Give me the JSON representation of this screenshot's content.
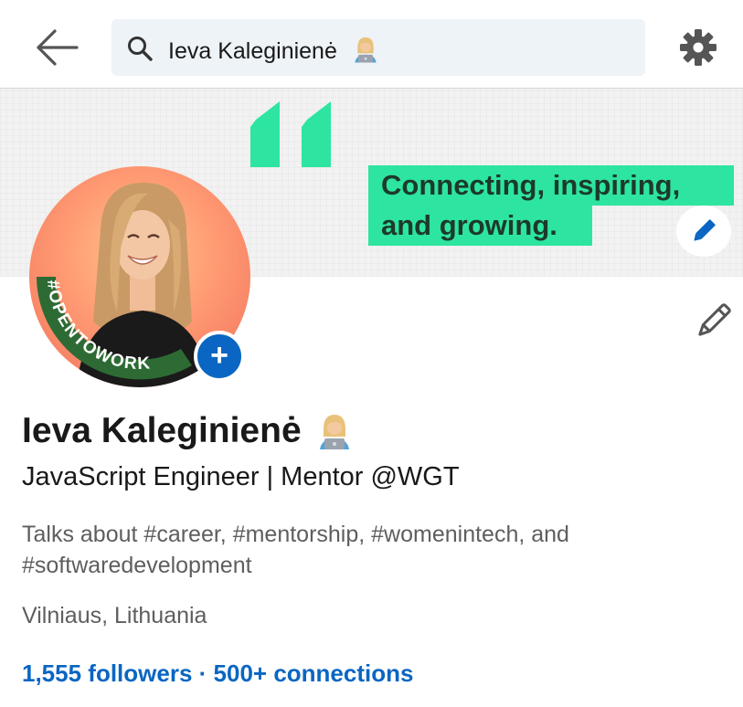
{
  "search": {
    "query": "Ieva Kaleginienė"
  },
  "icons": {
    "back": "arrow-left-icon",
    "search": "search-icon",
    "settings": "gear-icon",
    "edit": "pencil-icon",
    "add": "plus-icon",
    "emoji": "technologist-emoji-icon"
  },
  "banner": {
    "quote_line1": "Connecting, inspiring,",
    "quote_line2": "and growing."
  },
  "avatar": {
    "badge_text": "#OPENTOWORK",
    "add_symbol": "+"
  },
  "profile": {
    "name": "Ieva Kaleginienė",
    "headline": "JavaScript Engineer | Mentor @WGT",
    "about": "Talks about #career, #mentorship, #womenintech, and #softwaredevelopment",
    "location": "Vilniaus, Lithuania",
    "followers": "1,555 followers",
    "separator": " · ",
    "connections": "500+ connections"
  },
  "colors": {
    "accent": "#0a66c2",
    "quote_green": "#2de5a0",
    "open_to_work_green": "#2e6b34",
    "muted_text": "#5e5e5e"
  }
}
